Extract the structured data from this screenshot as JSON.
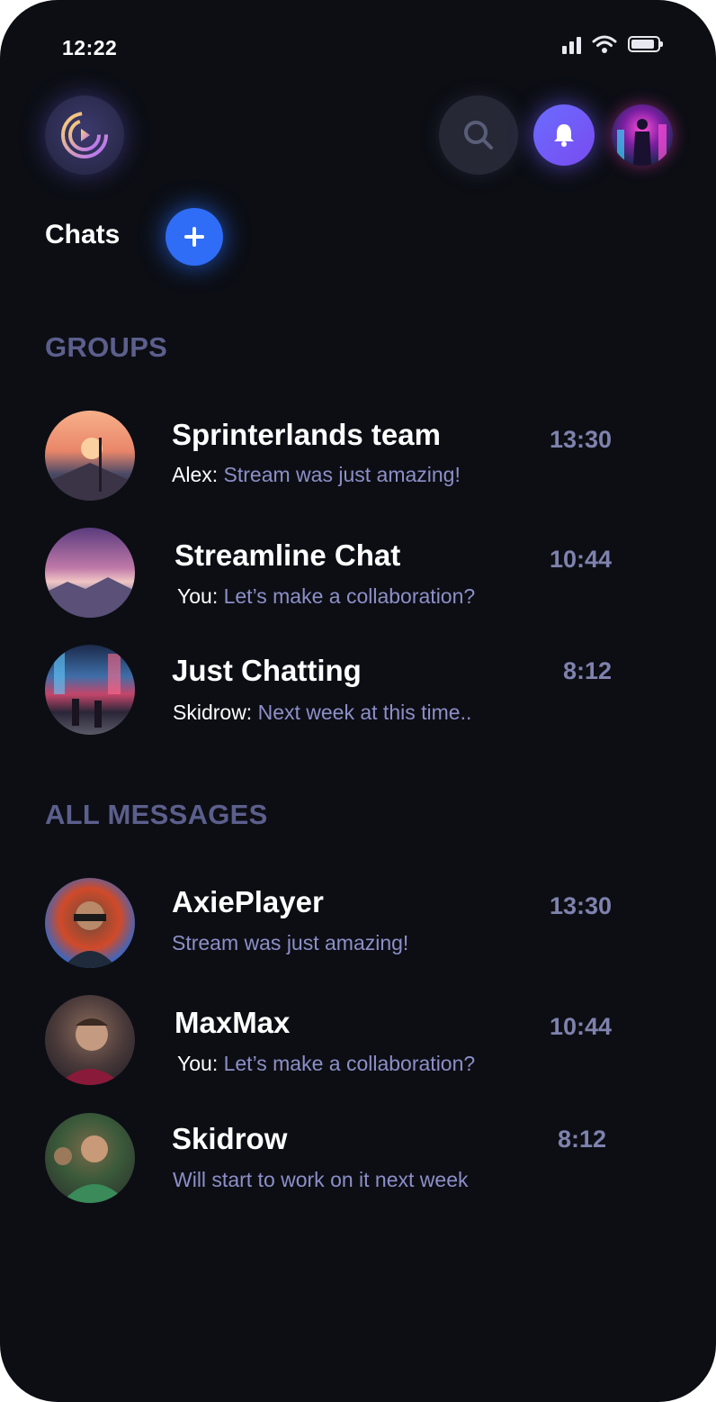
{
  "status_bar": {
    "time": "12:22",
    "battery_level": 0.9
  },
  "header": {
    "logo_icon": "play-ring-logo-icon",
    "search_icon": "search-icon",
    "notification_icon": "bell-icon",
    "profile_avatar": "cyberpunk-avatar"
  },
  "chats": {
    "title": "Chats",
    "add_icon": "plus-icon"
  },
  "groups": {
    "label": "GROUPS",
    "items": [
      {
        "name": "Sprinterlands team",
        "sender": "Alex:",
        "message": "Stream was just amazing!",
        "time": "13:30"
      },
      {
        "name": "Streamline Chat",
        "sender": "You:",
        "message": "Let’s make a collaboration?",
        "time": "10:44"
      },
      {
        "name": "Just Chatting",
        "sender": "Skidrow:",
        "message": "Next week at this time..",
        "time": "8:12"
      }
    ]
  },
  "all_messages": {
    "label": "ALL MESSAGES",
    "items": [
      {
        "name": "AxiePlayer",
        "sender": "",
        "message": "Stream was just amazing!",
        "time": "13:30"
      },
      {
        "name": "MaxMax",
        "sender": "You:",
        "message": "Let’s make a collaboration?",
        "time": "10:44"
      },
      {
        "name": "Skidrow",
        "sender": "",
        "message": "Will start to work on it next week",
        "time": "8:12"
      }
    ]
  },
  "colors": {
    "background": "#0c0e14",
    "accent_blue": "#2f6df6",
    "accent_purple": "#6a6cff",
    "section_label": "#5c5f8c",
    "preview_text": "#8d8fc8"
  }
}
